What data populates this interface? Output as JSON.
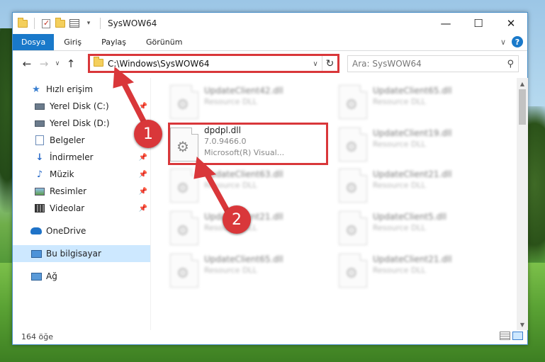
{
  "window": {
    "title": "SysWOW64",
    "controls": {
      "minimize": "—",
      "maximize": "☐",
      "close": "✕"
    }
  },
  "ribbon": {
    "tabs": [
      {
        "label": "Dosya"
      },
      {
        "label": "Giriş"
      },
      {
        "label": "Paylaş"
      },
      {
        "label": "Görünüm"
      }
    ]
  },
  "nav": {
    "address": "C:\\Windows\\SysWOW64",
    "search_placeholder": "Ara: SysWOW64"
  },
  "sidebar": {
    "items": [
      {
        "label": "Hızlı erişim",
        "icon": "star-icon"
      },
      {
        "label": "Yerel Disk (C:)",
        "icon": "drive-icon"
      },
      {
        "label": "Yerel Disk (D:)",
        "icon": "drive-icon"
      },
      {
        "label": "Belgeler",
        "icon": "documents-icon"
      },
      {
        "label": "İndirmeler",
        "icon": "download-icon"
      },
      {
        "label": "Müzik",
        "icon": "music-icon"
      },
      {
        "label": "Resimler",
        "icon": "pictures-icon"
      },
      {
        "label": "Videolar",
        "icon": "videos-icon"
      },
      {
        "label": "OneDrive",
        "icon": "cloud-icon"
      },
      {
        "label": "Bu bilgisayar",
        "icon": "computer-icon"
      },
      {
        "label": "Ağ",
        "icon": "network-icon"
      }
    ]
  },
  "files": [
    {
      "name": "UpdateClient42.dll",
      "sub": "Resource DLL"
    },
    {
      "name": "UpdateClient65.dll",
      "sub": "Resource DLL"
    },
    {
      "name": "dpdpl.dll",
      "version": "7.0.9466.0",
      "sub": "Microsoft(R) Visual..."
    },
    {
      "name": "UpdateClient19.dll",
      "sub": "Resource DLL"
    },
    {
      "name": "UpdateClient63.dll",
      "sub": "Resource DLL"
    },
    {
      "name": "UpdateClient21.dll",
      "sub": "Resource DLL"
    },
    {
      "name": "UpdateClient21.dll",
      "sub": "Resource DLL"
    },
    {
      "name": "UpdateClient5.dll",
      "sub": "Resource DLL"
    },
    {
      "name": "UpdateClient65.dll",
      "sub": "Resource DLL"
    },
    {
      "name": "UpdateClient21.dll",
      "sub": "Resource DLL"
    }
  ],
  "status": {
    "count": "164 öğe"
  },
  "annotations": {
    "marker1": "1",
    "marker2": "2"
  },
  "colors": {
    "accent": "#1979ca",
    "highlight": "#d9373a",
    "selected": "#cde8ff"
  }
}
